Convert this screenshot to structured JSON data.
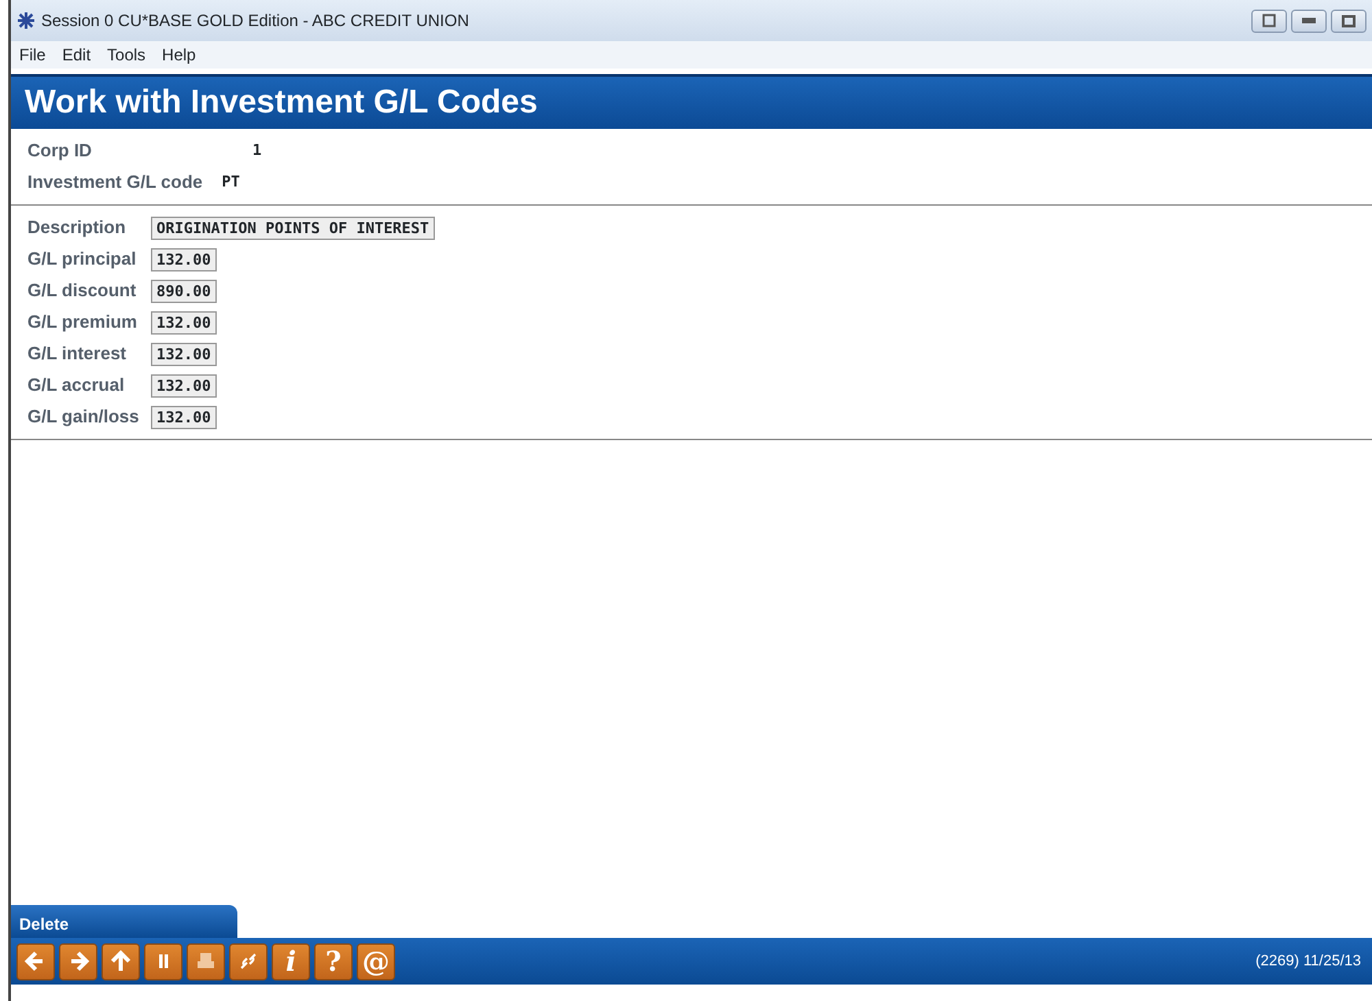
{
  "window": {
    "title": "Session 0 CU*BASE GOLD Edition - ABC CREDIT UNION"
  },
  "menu": [
    "File",
    "Edit",
    "Tools",
    "Help"
  ],
  "header": "Work with Investment G/L Codes",
  "info": [
    {
      "label": "Corp ID",
      "value": "1"
    },
    {
      "label": "Investment G/L code",
      "value": "PT"
    }
  ],
  "fields": [
    {
      "label": "Description",
      "value": "ORIGINATION POINTS OF INTEREST"
    },
    {
      "label": "G/L principal",
      "value": "132.00"
    },
    {
      "label": "G/L discount",
      "value": "890.00"
    },
    {
      "label": "G/L premium",
      "value": "132.00"
    },
    {
      "label": "G/L interest",
      "value": "132.00"
    },
    {
      "label": "G/L accrual",
      "value": "132.00"
    },
    {
      "label": "G/L gain/loss",
      "value": "132.00"
    }
  ],
  "action_tab": "Delete",
  "toolbar": [
    {
      "kind": "back"
    },
    {
      "kind": "forward"
    },
    {
      "kind": "up"
    },
    {
      "kind": "pause"
    },
    {
      "kind": "print"
    },
    {
      "kind": "link"
    },
    {
      "kind": "glyph",
      "text": "i"
    },
    {
      "kind": "glyph",
      "text": "?"
    },
    {
      "kind": "glyph",
      "text": "@"
    }
  ],
  "status": "(2269) 11/25/13"
}
